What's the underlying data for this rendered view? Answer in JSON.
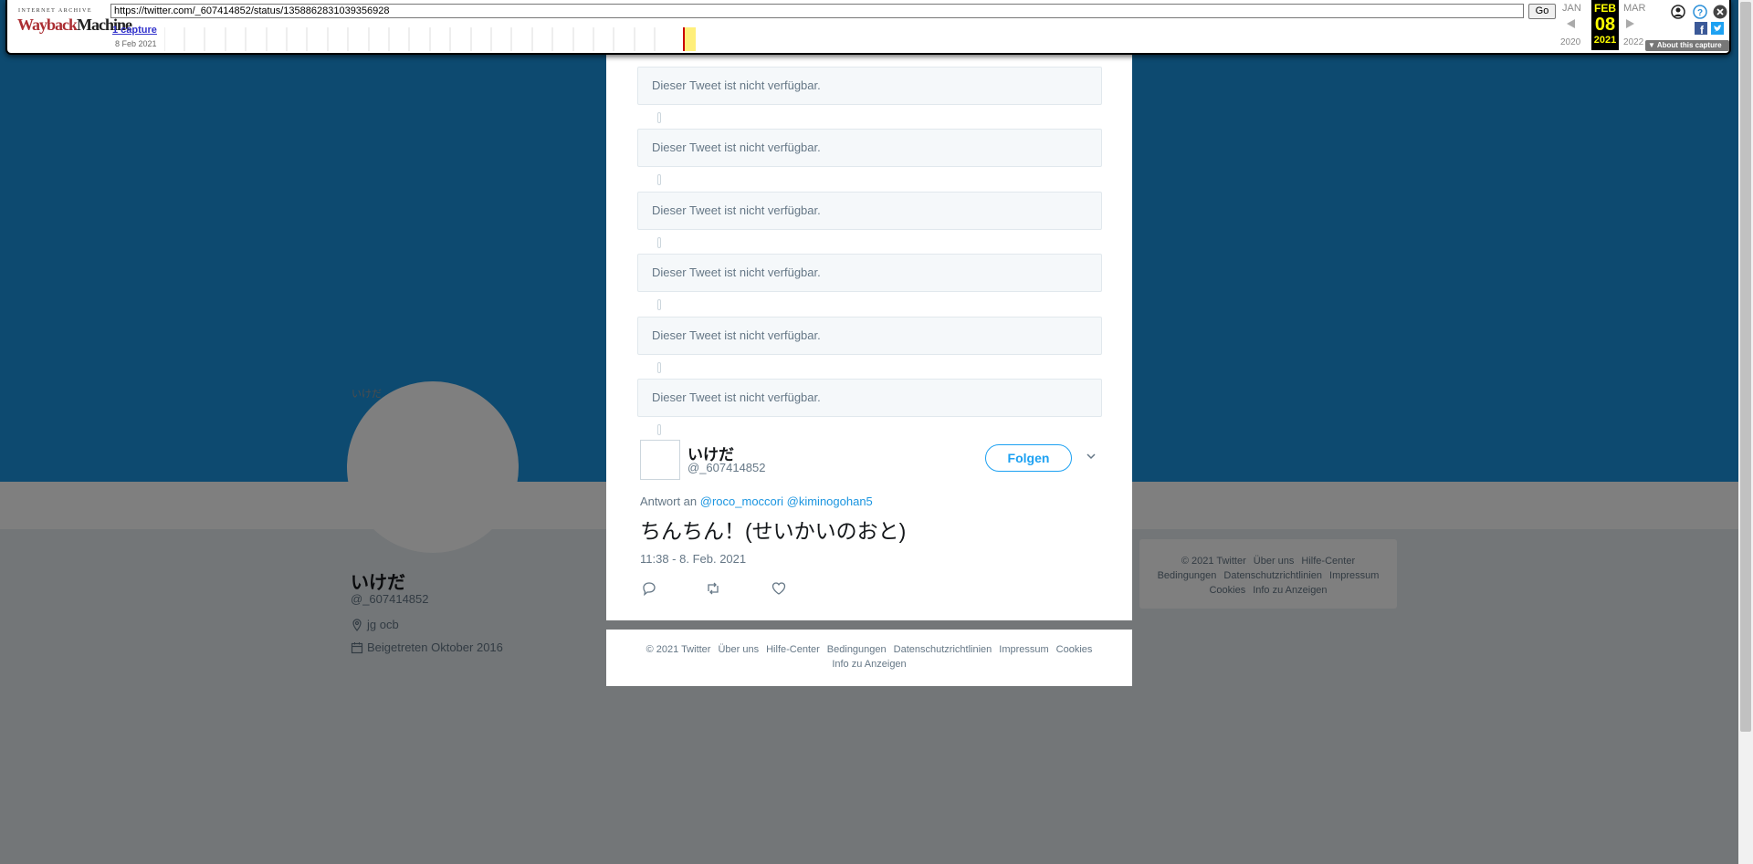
{
  "wayback": {
    "logo_top": "INTERNET ARCHIVE",
    "logo_way": "Wayback",
    "logo_machine": "Machine",
    "url": "https://twitter.com/_607414852/status/1358862831039356928",
    "go_label": "Go",
    "captures_label": "1 capture",
    "capture_date": "8 Feb 2021",
    "prev_month": "JAN",
    "prev_year": "2020",
    "current_month": "FEB",
    "current_day": "08",
    "current_year": "2021",
    "next_month": "MAR",
    "next_year": "2022",
    "about_label": "▼ About this capture"
  },
  "profile": {
    "avatar_alt": "いけだ",
    "name": "いけだ",
    "handle": "@_607414852",
    "location": "jg ocb",
    "joined": "Beigetreten Oktober 2016"
  },
  "side_footer": [
    "© 2021 Twitter",
    "Über uns",
    "Hilfe-Center",
    "Bedingungen",
    "Datenschutzrichtlinien",
    "Impressum",
    "Cookies",
    "Info zu Anzeigen"
  ],
  "thread": {
    "unavailable_text": "Dieser Tweet ist nicht verfügbar.",
    "unavailable": [
      "Dieser Tweet ist nicht verfügbar.",
      "Dieser Tweet ist nicht verfügbar.",
      "Dieser Tweet ist nicht verfügbar.",
      "Dieser Tweet ist nicht verfügbar.",
      "Dieser Tweet ist nicht verfügbar.",
      "Dieser Tweet ist nicht verfügbar."
    ]
  },
  "tweet": {
    "name": "いけだ",
    "handle": "@_607414852",
    "follow_label": "Folgen",
    "reply_prefix": "Antwort an",
    "reply_users": [
      "@roco_moccori",
      "@kiminogohan5"
    ],
    "text": "ちんちん！(せいかいのおと)",
    "timestamp": "11:38 - 8. Feb. 2021"
  },
  "modal_footer": [
    "© 2021 Twitter",
    "Über uns",
    "Hilfe-Center",
    "Bedingungen",
    "Datenschutzrichtlinien",
    "Impressum",
    "Cookies",
    "Info zu Anzeigen"
  ],
  "icons": {
    "reply": "reply-icon",
    "retweet": "retweet-icon",
    "like": "heart-icon",
    "caret": "chevron-down-icon"
  },
  "colors": {
    "banner": "#1b95e0",
    "accent": "#1da1f2"
  }
}
